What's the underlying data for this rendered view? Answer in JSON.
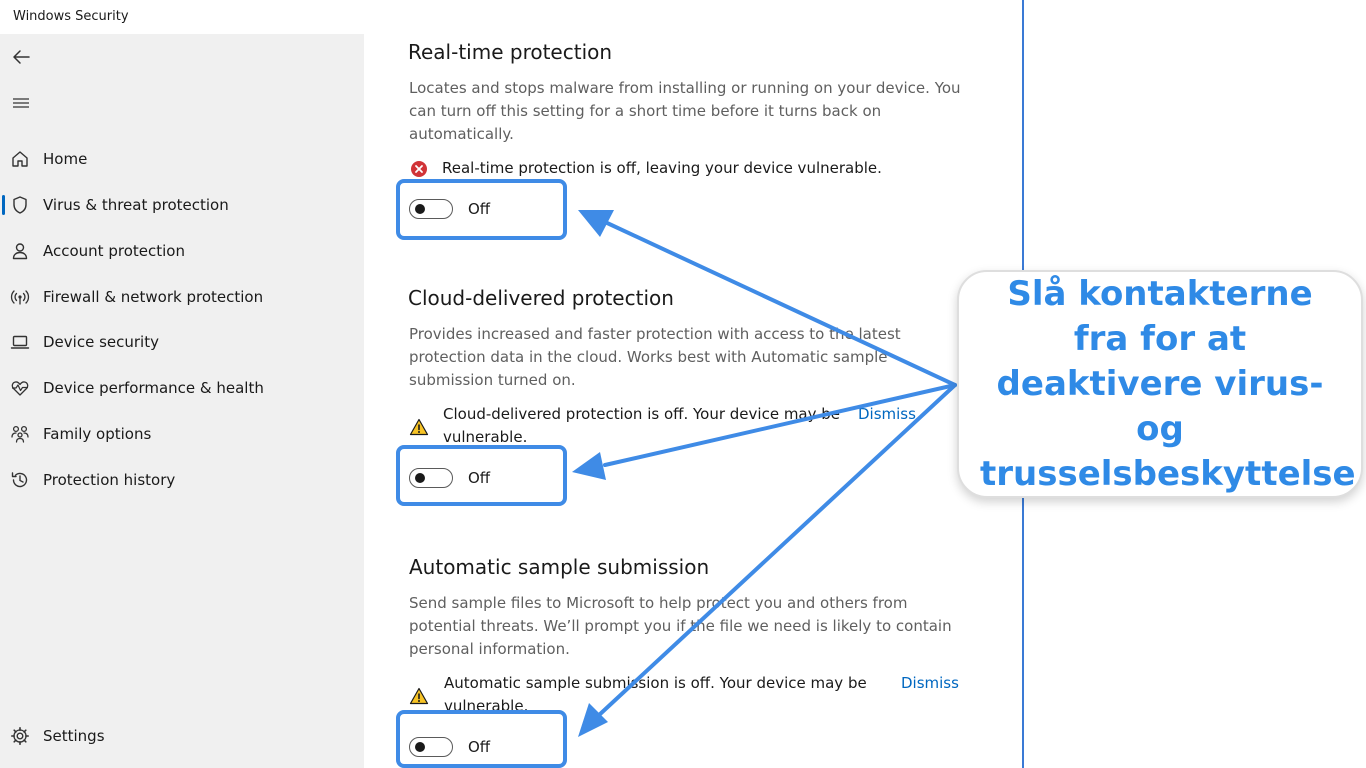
{
  "window": {
    "title": "Windows Security"
  },
  "sidebar": {
    "items": [
      {
        "label": "Home",
        "icon": "home-icon"
      },
      {
        "label": "Virus & threat protection",
        "icon": "shield-icon",
        "active": true
      },
      {
        "label": "Account protection",
        "icon": "person-icon"
      },
      {
        "label": "Firewall & network protection",
        "icon": "wifi-antenna-icon"
      },
      {
        "label": "Device security",
        "icon": "laptop-icon"
      },
      {
        "label": "Device performance & health",
        "icon": "heart-pulse-icon"
      },
      {
        "label": "Family options",
        "icon": "family-icon"
      },
      {
        "label": "Protection history",
        "icon": "history-icon"
      }
    ],
    "settings_label": "Settings"
  },
  "sections": [
    {
      "title": "Real-time protection",
      "description": "Locates and stops malware from installing or running on your device. You can turn off this setting for a short time before it turns back on automatically.",
      "status_text": "Real-time protection is off, leaving your device vulnerable.",
      "status_icon": "error-icon",
      "toggle_label": "Off"
    },
    {
      "title": "Cloud-delivered protection",
      "description": "Provides increased and faster protection with access to the latest protection data in the cloud. Works best with Automatic sample submission turned on.",
      "status_text": "Cloud-delivered protection is off. Your device may be vulnerable.",
      "status_icon": "warning-icon",
      "dismiss_label": "Dismiss",
      "toggle_label": "Off"
    },
    {
      "title": "Automatic sample submission",
      "description": "Send sample files to Microsoft to help protect you and others from potential threats. We’ll prompt you if the file we need is likely to contain personal information.",
      "status_text": "Automatic sample submission is off. Your device may be vulnerable.",
      "status_icon": "warning-icon",
      "dismiss_label": "Dismiss",
      "toggle_label": "Off"
    }
  ],
  "annotation": {
    "text": "Slå kontakterne fra for at deaktivere virus- og trusselsbeskyttelse",
    "color": "#2f8ae6"
  },
  "colors": {
    "accent": "#0067c0",
    "highlight": "#3f8be6",
    "error": "#d13438",
    "warning": "#f7c325"
  }
}
